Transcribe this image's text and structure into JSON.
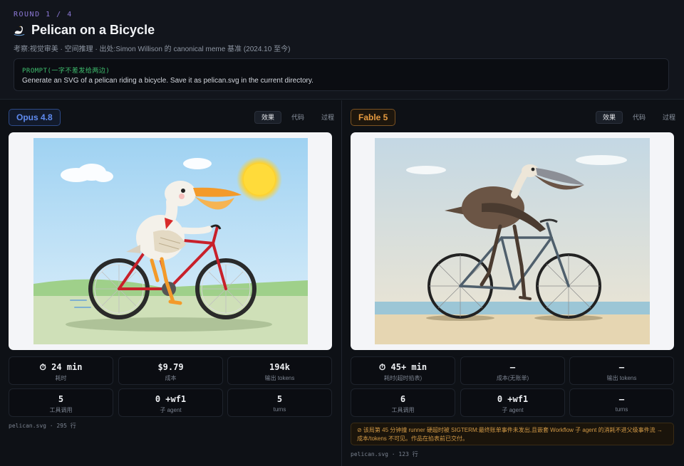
{
  "header": {
    "round": "ROUND 1 / 4",
    "title": "Pelican on a Bicycle",
    "subtitle": "考察:视觉审美 · 空间推理 · 出处:Simon Willison 的 canonical meme 基准 (2024.10 至今)",
    "prompt_label": "PROMPT(一字不差发给两边)",
    "prompt_text": "Generate an SVG of a pelican riding a bicycle. Save it as pelican.svg in the current directory."
  },
  "tabs": [
    "效果",
    "代码",
    "过程"
  ],
  "left": {
    "model": "Opus 4.8",
    "stats": [
      {
        "value": "⏱ 24 min",
        "label": "耗时"
      },
      {
        "value": "$9.79",
        "label": "成本"
      },
      {
        "value": "194k",
        "label": "输出 tokens"
      },
      {
        "value": "5",
        "label": "工具调用"
      },
      {
        "value": "0 +wf1",
        "label": "子 agent"
      },
      {
        "value": "5",
        "label": "turns"
      }
    ],
    "footer": "pelican.svg · 295 行"
  },
  "right": {
    "model": "Fable 5",
    "stats": [
      {
        "value": "⏱ 45+ min",
        "label": "耗时(超时掐表)"
      },
      {
        "value": "—",
        "label": "成本(无账单)"
      },
      {
        "value": "—",
        "label": "输出 tokens"
      },
      {
        "value": "6",
        "label": "工具调用"
      },
      {
        "value": "0 +wf1",
        "label": "子 agent"
      },
      {
        "value": "—",
        "label": "turns"
      }
    ],
    "warning": "⊘ 该局第 45 分钟撞 runner 硬超时被 SIGTERM:最终账单事件未发出,且嵌套 Workflow 子 agent 的消耗不进父级事件流 → 成本/tokens 不可见。作品在掐表前已交付。",
    "footer": "pelican.svg · 123 行"
  },
  "colors": {
    "accent_purple": "#8d79d8",
    "accent_blue": "#5f8bf0",
    "accent_orange": "#e59a3f",
    "prompt_green": "#3fbf6f"
  }
}
